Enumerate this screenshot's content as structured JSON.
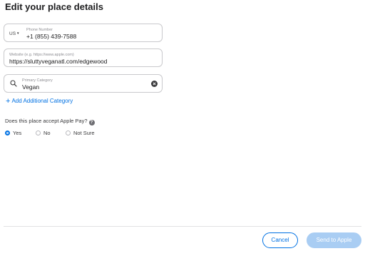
{
  "page": {
    "title": "Edit your place details"
  },
  "phone": {
    "country": "US",
    "label": "Phone Number",
    "value": "+1 (855) 439-7588"
  },
  "website": {
    "placeholder": "Website (e.g. https://www.apple.com)",
    "value": "https://sluttyveganatl.com/edgewood"
  },
  "category": {
    "label": "Primary Category",
    "value": "Vegan",
    "add_label": "Add Additional Category"
  },
  "apple_pay": {
    "question": "Does this place accept Apple Pay?",
    "options": [
      {
        "label": "Yes",
        "selected": true
      },
      {
        "label": "No",
        "selected": false
      },
      {
        "label": "Not Sure",
        "selected": false
      }
    ]
  },
  "footer": {
    "cancel_label": "Cancel",
    "send_label": "Send to Apple"
  },
  "colors": {
    "accent": "#0071e3",
    "disabled_button": "#a9cdf3"
  },
  "icons": {
    "country_picker": "chevron-down-icon",
    "category_search": "search-icon",
    "category_clear": "clear-icon",
    "add_category": "plus-icon",
    "apple_pay_help": "question-mark-icon"
  }
}
